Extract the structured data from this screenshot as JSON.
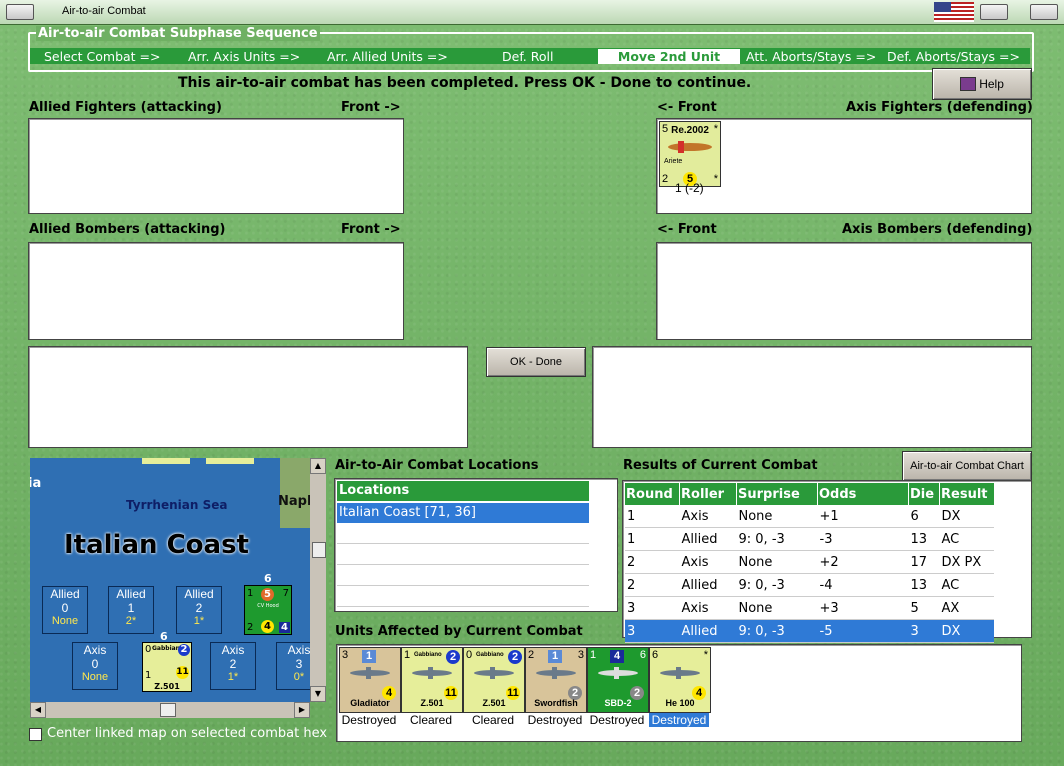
{
  "window": {
    "title": "Air-to-air Combat"
  },
  "sequence": {
    "title": "Air-to-air Combat Subphase Sequence",
    "steps": [
      "Select Combat =>",
      "Arr. Axis Units =>",
      "Arr. Allied Units =>",
      "Def. Roll",
      "Move 2nd Unit",
      "Att. Aborts/Stays =>",
      "Def. Aborts/Stays =>"
    ],
    "active_step": "Move 2nd Unit"
  },
  "message": "This air-to-air combat has been completed.  Press OK - Done to continue.",
  "help_label": "Help",
  "sections": {
    "allied_fighters": "Allied Fighters (attacking)",
    "allied_bombers": "Allied Bombers (attacking)",
    "axis_fighters": "Axis Fighters (defending)",
    "axis_bombers": "Axis Bombers (defending)",
    "front_right": "Front ->",
    "front_left": "<- Front"
  },
  "axis_fighter_unit": {
    "name": "Re.2002",
    "sub": "Ariete",
    "tl": "5",
    "tr": "*",
    "bl": "2",
    "mid": "5",
    "br": "*",
    "caption": "1 (-2)"
  },
  "ok_label": "OK - Done",
  "map": {
    "sea_label": "Tyrrhenian Sea",
    "coast_label": "Italian Coast",
    "napl_label": "Napl",
    "ia_label": "ia",
    "boxes": [
      {
        "side": "Allied",
        "num": "0",
        "sub": "None"
      },
      {
        "side": "Allied",
        "num": "1",
        "sub": "2*"
      },
      {
        "side": "Allied",
        "num": "2",
        "sub": "1*"
      },
      {
        "side": "Axis",
        "num": "0",
        "sub": "None"
      },
      {
        "side": "Axis",
        "num": "2",
        "sub": "1*"
      },
      {
        "side": "Axis",
        "num": "3",
        "sub": "0*"
      }
    ],
    "stack_a": {
      "count": "6",
      "tl": "1",
      "c": "5",
      "tr": "7",
      "bl": "2",
      "mid": "4",
      "br": "4",
      "name": "CV Hood"
    },
    "stack_b": {
      "count": "6",
      "tl": "0",
      "name": "Gabbiano",
      "c": "2",
      "bl": "1",
      "mid": "11",
      "bottom": "Z.501"
    }
  },
  "center_checkbox_label": "Center linked map on selected combat hex",
  "locations": {
    "title": "Air-to-Air Combat Locations",
    "header": "Locations",
    "items": [
      "Italian Coast [71, 36]"
    ]
  },
  "results": {
    "title": "Results of Current Combat",
    "chart_button": "Air-to-air Combat Chart",
    "columns": [
      "Round",
      "Roller",
      "Surprise",
      "Odds",
      "Die",
      "Result"
    ],
    "rows": [
      [
        "1",
        "Axis",
        "None",
        "+1",
        "6",
        "DX"
      ],
      [
        "1",
        "Allied",
        "9: 0, -3",
        "-3",
        "13",
        "AC"
      ],
      [
        "2",
        "Axis",
        "None",
        "+2",
        "17",
        "DX PX"
      ],
      [
        "2",
        "Allied",
        "9: 0, -3",
        "-4",
        "13",
        "AC"
      ],
      [
        "3",
        "Axis",
        "None",
        "+3",
        "5",
        "AX"
      ],
      [
        "3",
        "Allied",
        "9: 0, -3",
        "-5",
        "3",
        "DX"
      ]
    ],
    "selected_row": 5
  },
  "affected": {
    "title": "Units Affected by Current Combat",
    "units": [
      {
        "name": "Gladiator",
        "tl": "3",
        "sq": "1",
        "mid": "4",
        "status": "Destroyed",
        "bg": "#d8c49a"
      },
      {
        "name": "Z.501",
        "top": "Gabbiano",
        "tl": "1",
        "circ": "2",
        "mid": "11",
        "status": "Cleared",
        "bg": "#e6ee9a"
      },
      {
        "name": "Z.501",
        "top": "Gabbiano",
        "tl": "0",
        "circ": "2",
        "mid": "11",
        "status": "Cleared",
        "bg": "#e6ee9a"
      },
      {
        "name": "Swordfish",
        "tl": "2",
        "sq": "1",
        "tr": "3",
        "mid": "2",
        "status": "Destroyed",
        "bg": "#d8c49a"
      },
      {
        "name": "SBD-2",
        "tl": "1",
        "sq": "4",
        "tr": "6",
        "mid": "2",
        "status": "Destroyed",
        "bg": "#1e9a2e"
      },
      {
        "name": "He 100",
        "tl": "6",
        "tr": "*",
        "mid": "4",
        "status": "Destroyed",
        "bg": "#e6ee9a"
      }
    ]
  }
}
